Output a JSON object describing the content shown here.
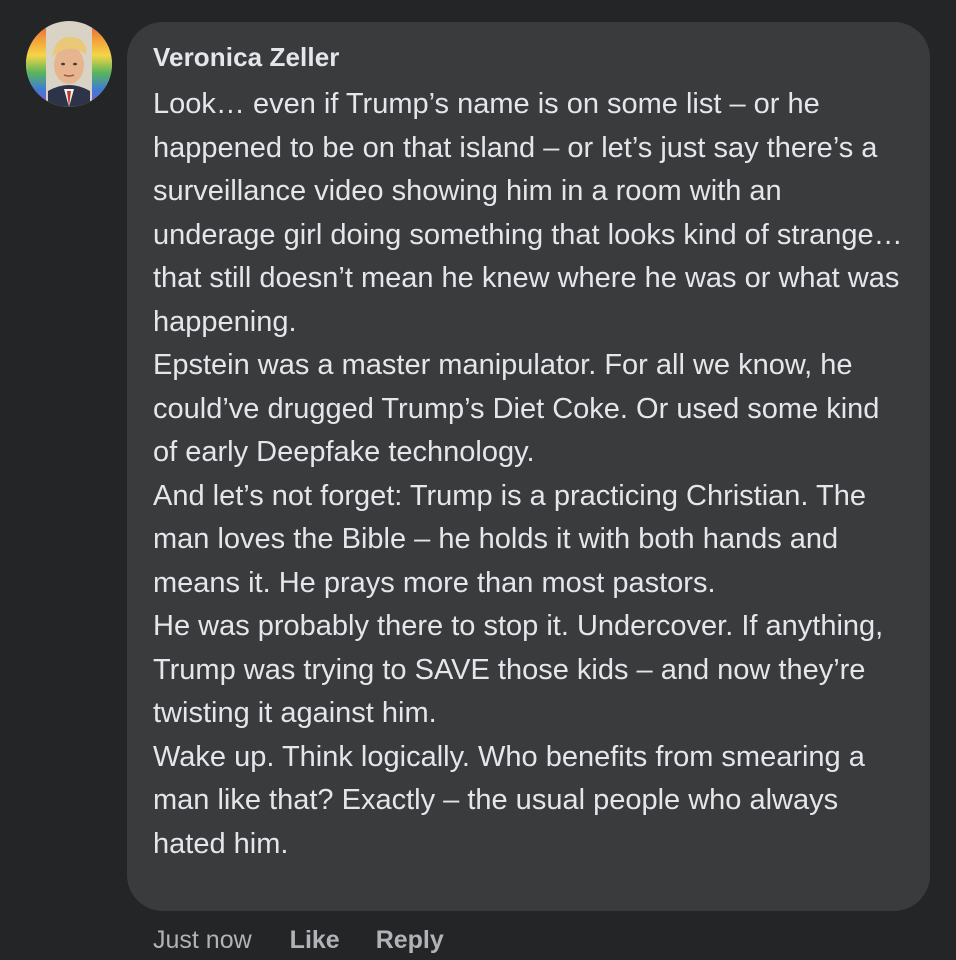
{
  "comment": {
    "author": "Veronica Zeller",
    "avatar_icon": "profile-photo-icon",
    "paragraphs": [
      "Look… even if Trump’s name is on some list – or he happened to be on that island – or let’s just say there’s a surveillance video showing him in a room with an underage girl doing something that looks kind of strange… that still doesn’t mean he knew where he was or what was happening.",
      "Epstein was a master manipulator. For all we know, he could’ve drugged Trump’s Diet Coke. Or used some kind of early Deepfake technology.",
      "And let’s not forget: Trump is a practicing Christian. The man loves the Bible – he holds it with both hands and means it. He prays more than most pastors.",
      "He was probably there to stop it. Undercover. If anything, Trump was trying to SAVE those kids – and now they’re twisting it against him.",
      "Wake up. Think logically. Who benefits from smearing a man like that? Exactly – the usual people who always hated him."
    ],
    "timestamp": "Just now",
    "like_label": "Like",
    "reply_label": "Reply"
  },
  "colors": {
    "background": "#242526",
    "bubble": "#3a3b3c",
    "text": "#e4e6eb",
    "secondary_text": "#b0b3b8"
  }
}
